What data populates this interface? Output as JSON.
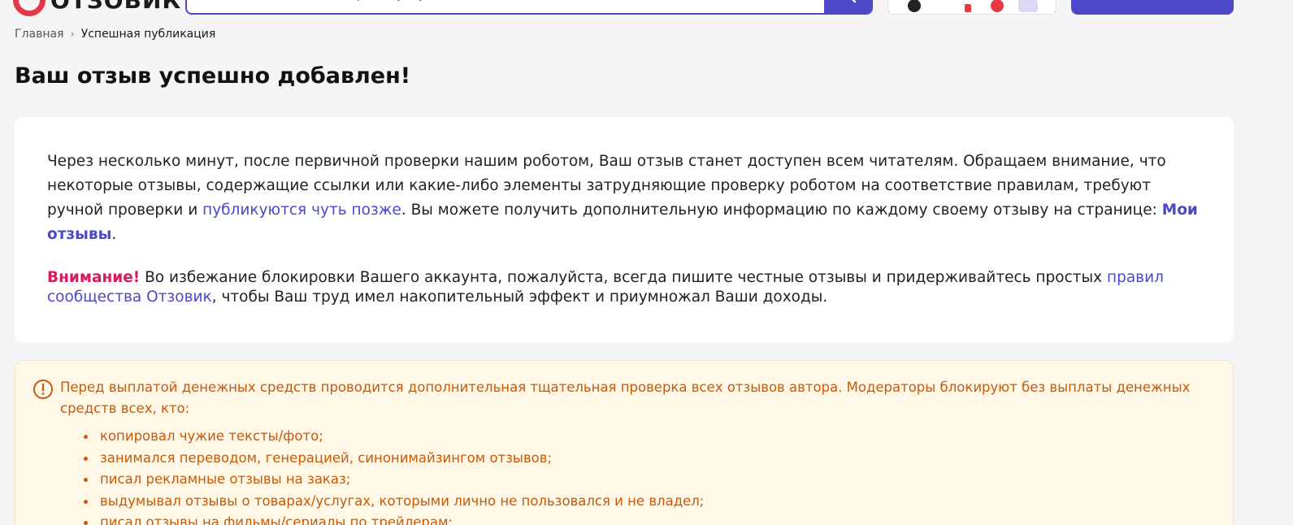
{
  "header": {
    "logo_text": "ОТЗОВИК",
    "search_placeholder": "Поиск по отзывам, товарам и услугам"
  },
  "breadcrumb": {
    "home": "Главная",
    "separator": "›",
    "current": "Успешная публикация"
  },
  "page_title": "Ваш отзыв успешно добавлен!",
  "card": {
    "p1_text1": "Через несколько минут, после первичной проверки нашим роботом, Ваш отзыв станет доступен всем читателям. Обращаем внимание, что некоторые отзывы, содержащие ссылки или какие-либо элементы затрудняющие проверку роботом на соответствие правилам, требуют ручной проверки и ",
    "p1_link": "публикуются чуть позже",
    "p1_text2": ". Вы можете получить дополнительную информацию по каждому своему отзыву на странице: ",
    "my_reviews_link": "Мои отзывы",
    "p1_end": ".",
    "attention_label": "Внимание!",
    "p2_text1": " Во избежание блокировки Вашего аккаунта, пожалуйста, всегда пишите честные отзывы и придерживайтесь простых ",
    "rules_link": "правил сообщества Отзовик",
    "p2_text2": ", чтобы Ваш труд имел накопительный эффект и приумножал Ваши доходы."
  },
  "warning": {
    "intro": "Перед выплатой денежных средств проводится дополнительная тщательная проверка всех отзывов автора. Модераторы блокируют без выплаты денежных средств всех, кто:",
    "items": [
      "копировал чужие тексты/фото;",
      "занимался переводом, генерацией, синонимайзингом отзывов;",
      "писал рекламные отзывы на заказ;",
      "выдумывал отзывы о товарах/услугах, которыми лично не пользовался и не владел;",
      "писал отзывы на фильмы/сериалы по трейлерам;"
    ]
  },
  "colors": {
    "accent": "#4b48c9",
    "brand_red": "#e63946",
    "attention": "#d81b60",
    "warning_text": "#c85a0a",
    "warning_bg": "#fff8e7"
  }
}
